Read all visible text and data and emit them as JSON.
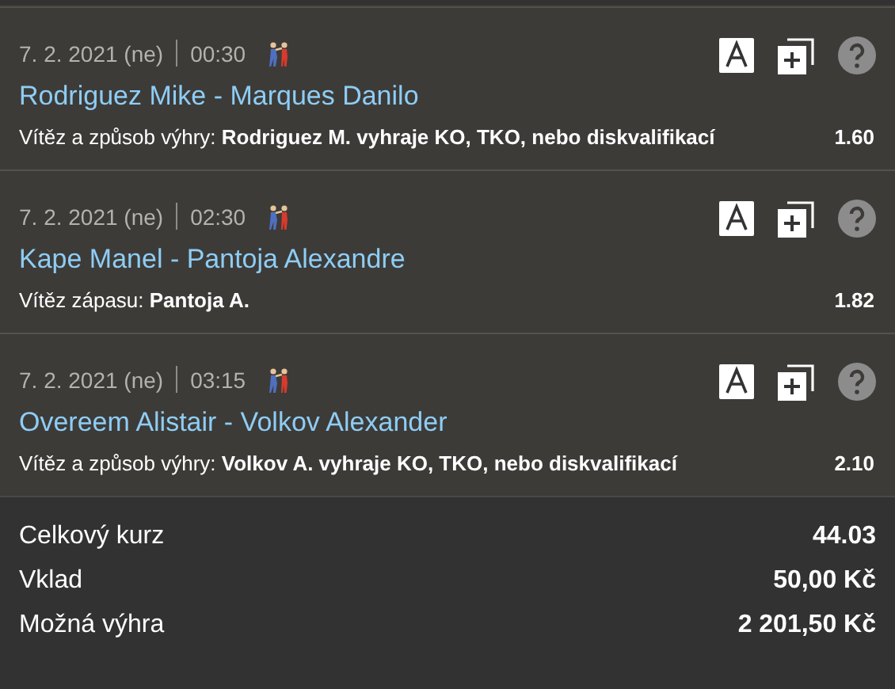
{
  "bets": [
    {
      "date": "7. 2. 2021 (ne)",
      "time": "00:30",
      "match": "Rodriguez Mike - Marques Danilo",
      "selection": "Vítěz a způsob výhry: **Rodriguez M. vyhraje KO, TKO, nebo diskvalifikací**",
      "odds": "1.60"
    },
    {
      "date": "7. 2. 2021 (ne)",
      "time": "02:30",
      "match": "Kape Manel - Pantoja Alexandre",
      "selection": "Vítěz zápasu: **Pantoja A.**",
      "odds": "1.82"
    },
    {
      "date": "7. 2. 2021 (ne)",
      "time": "03:15",
      "match": "Overeem Alistair - Volkov Alexander",
      "selection": "Vítěz a způsob výhry: **Volkov A. vyhraje KO, TKO, nebo diskvalifikací**",
      "odds": "2.10"
    }
  ],
  "summary": [
    {
      "label": "Celkový kurz",
      "value": "44.03"
    },
    {
      "label": "Vklad",
      "value": "50,00 Kč"
    },
    {
      "label": "Možná výhra",
      "value": "2 201,50 Kč"
    }
  ]
}
